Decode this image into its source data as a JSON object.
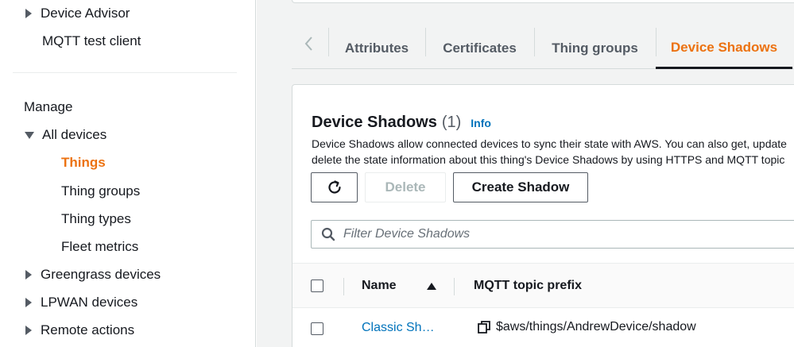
{
  "sidebar": {
    "top_items": [
      {
        "label": "Device Advisor",
        "expandable": true
      },
      {
        "label": "MQTT test client",
        "expandable": false
      }
    ],
    "section_heading": "Manage",
    "all_devices_label": "All devices",
    "all_devices_children": [
      "Things",
      "Thing groups",
      "Thing types",
      "Fleet metrics"
    ],
    "active_item": "Things",
    "bottom_items": [
      "Greengrass devices",
      "LPWAN devices",
      "Remote actions"
    ]
  },
  "tabs": {
    "items": [
      "Attributes",
      "Certificates",
      "Thing groups",
      "Device Shadows"
    ],
    "selected": "Device Shadows"
  },
  "panel": {
    "title": "Device Shadows",
    "count": "(1)",
    "info_label": "Info",
    "description_line1": "Device Shadows allow connected devices to sync their state with AWS. You can also get, update",
    "description_line2": "delete the state information about this thing's Device Shadows by using HTTPS and MQTT topic",
    "delete_label": "Delete",
    "create_label": "Create Shadow",
    "filter_placeholder": "Filter Device Shadows"
  },
  "table": {
    "columns": [
      "Name",
      "MQTT topic prefix"
    ],
    "sort": {
      "column": "Name",
      "direction": "ascending"
    },
    "rows": [
      {
        "name": "Classic Sh…",
        "topic": "$aws/things/AndrewDevice/shadow"
      }
    ]
  },
  "colors": {
    "accent": "#ec7211",
    "link": "#0073bb",
    "text": "#16191f",
    "background": "#f2f3f3"
  }
}
